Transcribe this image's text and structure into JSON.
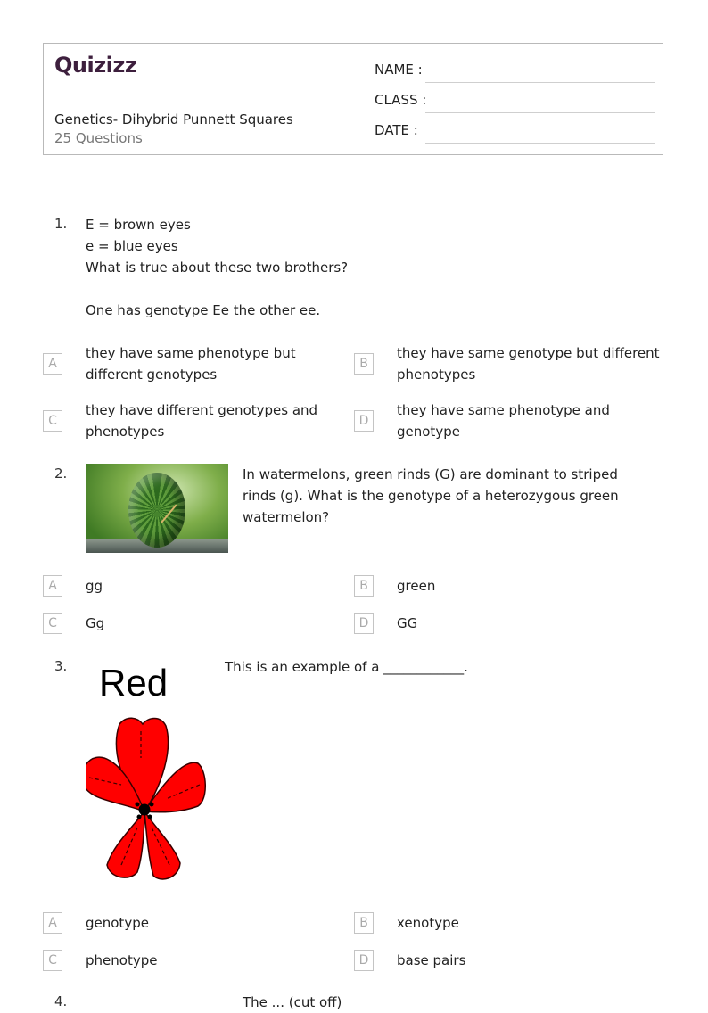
{
  "header": {
    "logo": "Quizizz",
    "title": "Genetics- Dihybrid Punnett Squares",
    "question_count": "25 Questions",
    "fields": {
      "name_label": "NAME :",
      "class_label": "CLASS :",
      "date_label": "DATE  :"
    }
  },
  "questions": [
    {
      "number": "1.",
      "lines": [
        "E = brown eyes",
        "e = blue eyes",
        "What is true about these two brothers?",
        "",
        "One has genotype Ee the other ee."
      ],
      "options": [
        {
          "letter": "A",
          "text": "they have same phenotype but different genotypes"
        },
        {
          "letter": "B",
          "text": "they have same genotype but different phenotypes"
        },
        {
          "letter": "C",
          "text": "they have different genotypes and phenotypes"
        },
        {
          "letter": "D",
          "text": "they have same phenotype and genotype"
        }
      ]
    },
    {
      "number": "2.",
      "image": "watermelon-photo",
      "text": "In watermelons, green rinds (G) are dominant to striped rinds (g).  What is the genotype of a heterozygous green watermelon?",
      "options": [
        {
          "letter": "A",
          "text": "gg"
        },
        {
          "letter": "B",
          "text": "green"
        },
        {
          "letter": "C",
          "text": "Gg"
        },
        {
          "letter": "D",
          "text": "GG"
        }
      ]
    },
    {
      "number": "3.",
      "image": "red-flower-illustration",
      "image_label": "Red",
      "text": "This is an example of a ____________.",
      "options": [
        {
          "letter": "A",
          "text": "genotype"
        },
        {
          "letter": "B",
          "text": "xenotype"
        },
        {
          "letter": "C",
          "text": "phenotype"
        },
        {
          "letter": "D",
          "text": "base pairs"
        }
      ]
    },
    {
      "number": "4.",
      "text": "The ... (cut off)"
    }
  ]
}
